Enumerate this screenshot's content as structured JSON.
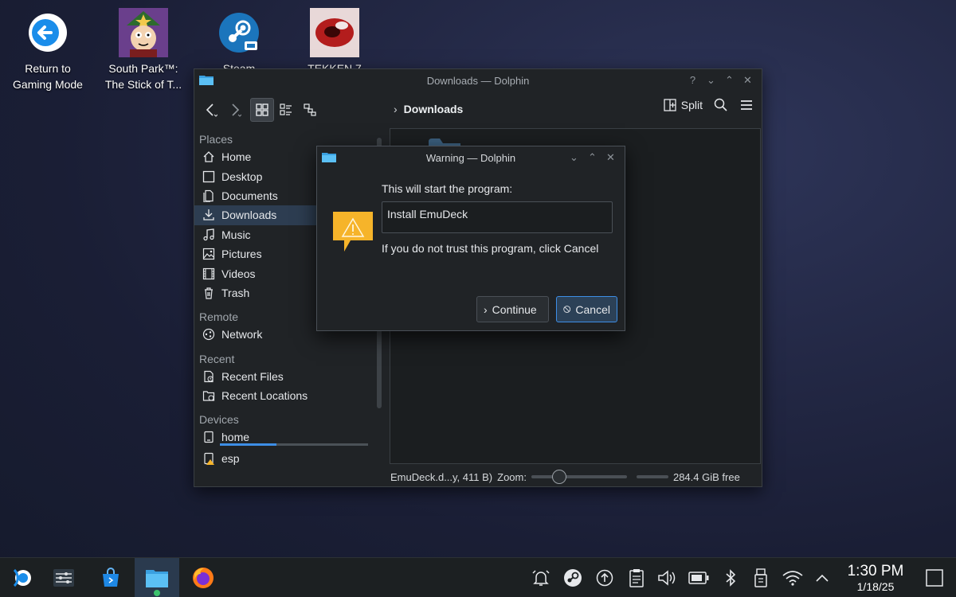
{
  "desktop": {
    "icons": [
      {
        "label": "Return to\nGaming Mode",
        "icon": "return-arrow-icon"
      },
      {
        "label": "South Park™:\nThe Stick of T...",
        "icon": "south-park-game-icon"
      },
      {
        "label": "Steam",
        "icon": "steam-icon"
      },
      {
        "label": "TEKKEN 7",
        "icon": "tekken-game-icon"
      }
    ]
  },
  "dolphin": {
    "title": "Downloads — Dolphin",
    "breadcrumb": "Downloads",
    "split_label": "Split",
    "sidebar": {
      "places_title": "Places",
      "places": [
        "Home",
        "Desktop",
        "Documents",
        "Downloads",
        "Music",
        "Pictures",
        "Videos",
        "Trash"
      ],
      "remote_title": "Remote",
      "remote": [
        "Network"
      ],
      "recent_title": "Recent",
      "recent": [
        "Recent Files",
        "Recent Locations"
      ],
      "devices_title": "Devices",
      "devices": [
        "home",
        "esp"
      ]
    },
    "status": {
      "file_info": "EmuDeck.d...y, 411 B)",
      "zoom_label": "Zoom:",
      "free_space": "284.4 GiB free"
    }
  },
  "dialog": {
    "title": "Warning — Dolphin",
    "message": "This will start the program:",
    "program": "Install EmuDeck",
    "note": "If you do not trust this program, click Cancel",
    "continue_label": "Continue",
    "cancel_label": "Cancel"
  },
  "taskbar": {
    "time": "1:30 PM",
    "date": "1/18/25"
  },
  "colors": {
    "accent": "#3d8ee6",
    "selection": "#2d3d51",
    "warning": "#f6b42a"
  }
}
